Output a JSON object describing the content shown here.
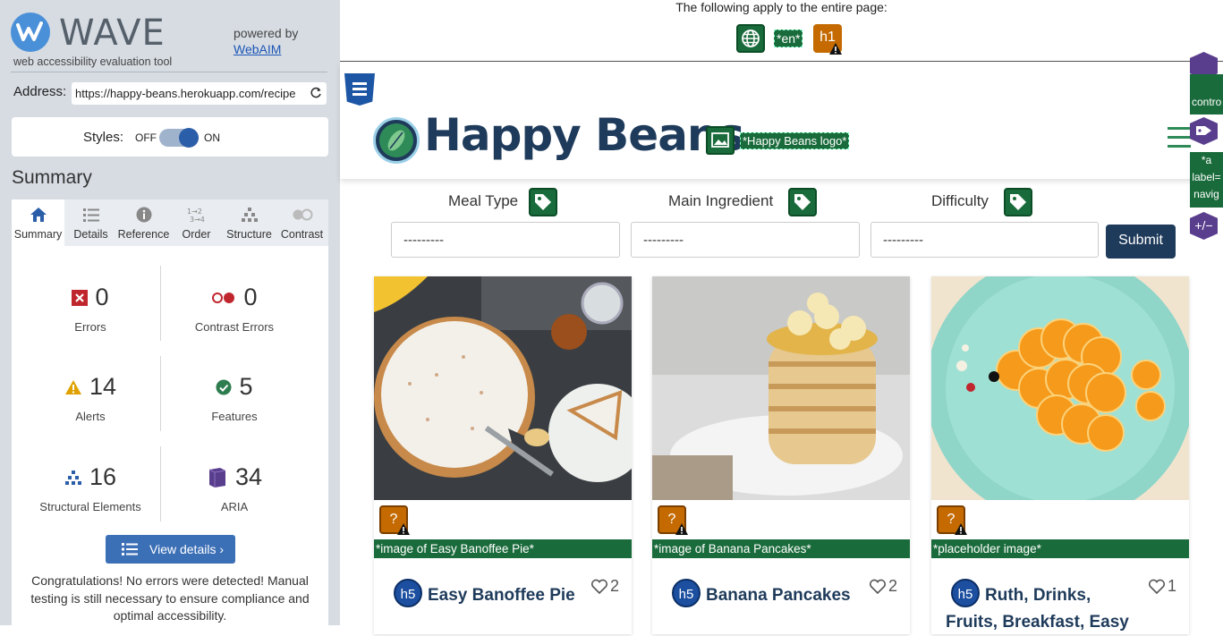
{
  "wave": {
    "title": "WAVE",
    "subtitle": "web accessibility evaluation tool",
    "powered_by": "powered by",
    "webaim_link": "WebAIM",
    "address_label": "Address:",
    "address_value": "https://happy-beans.herokuapp.com/recipe",
    "styles_label": "Styles:",
    "styles_off": "OFF",
    "styles_on": "ON",
    "summary_heading": "Summary",
    "tabs": [
      {
        "label": "Summary",
        "icon": "home-icon"
      },
      {
        "label": "Details",
        "icon": "list-icon"
      },
      {
        "label": "Reference",
        "icon": "info-icon"
      },
      {
        "label": "Order",
        "icon": "order-icon"
      },
      {
        "label": "Structure",
        "icon": "structure-icon"
      },
      {
        "label": "Contrast",
        "icon": "contrast-icon"
      }
    ],
    "stats": {
      "errors": {
        "value": "0",
        "label": "Errors"
      },
      "contrast_errors": {
        "value": "0",
        "label": "Contrast Errors"
      },
      "alerts": {
        "value": "14",
        "label": "Alerts"
      },
      "features": {
        "value": "5",
        "label": "Features"
      },
      "structural": {
        "value": "16",
        "label": "Structural Elements"
      },
      "aria": {
        "value": "34",
        "label": "ARIA"
      }
    },
    "view_details": "View details ›",
    "congrats": "Congratulations! No errors were detected! Manual testing is still necessary to ensure compliance and optimal accessibility."
  },
  "page": {
    "apply_text": "The following apply to the entire page:",
    "lang_badge": "*en*",
    "h1_badge": "h1",
    "site_name": "Happy Beans",
    "logo_alt": "*Happy Beans logo*",
    "side_tabs": [
      "contro",
      "*a",
      "label=",
      "navig",
      "+/−"
    ],
    "filters": [
      {
        "label": "Meal Type",
        "value": "---------"
      },
      {
        "label": "Main Ingredient",
        "value": "---------"
      },
      {
        "label": "Difficulty",
        "value": "---------"
      }
    ],
    "submit": "Submit",
    "cards": [
      {
        "alt": "*image of Easy Banoffee Pie*",
        "title": "Easy Banoffee Pie",
        "likes": "2",
        "heading": "h5",
        "badge": "?"
      },
      {
        "alt": "*image of Banana Pancakes*",
        "title": "Banana Pancakes",
        "likes": "2",
        "heading": "h5",
        "badge": "?"
      },
      {
        "alt": "*placeholder image*",
        "title": "Ruth, Drinks,",
        "title2": "Fruits, Breakfast, Easy",
        "likes": "1",
        "heading": "h5",
        "badge": "?"
      }
    ]
  },
  "colors": {
    "wave_panel": "#d7dce3",
    "wave_accent": "#3b6fb6",
    "feature_green": "#1a6b3b",
    "alert_orange": "#c46a00",
    "aria_purple": "#5a3e8e",
    "brand_navy": "#1f3b5b"
  }
}
